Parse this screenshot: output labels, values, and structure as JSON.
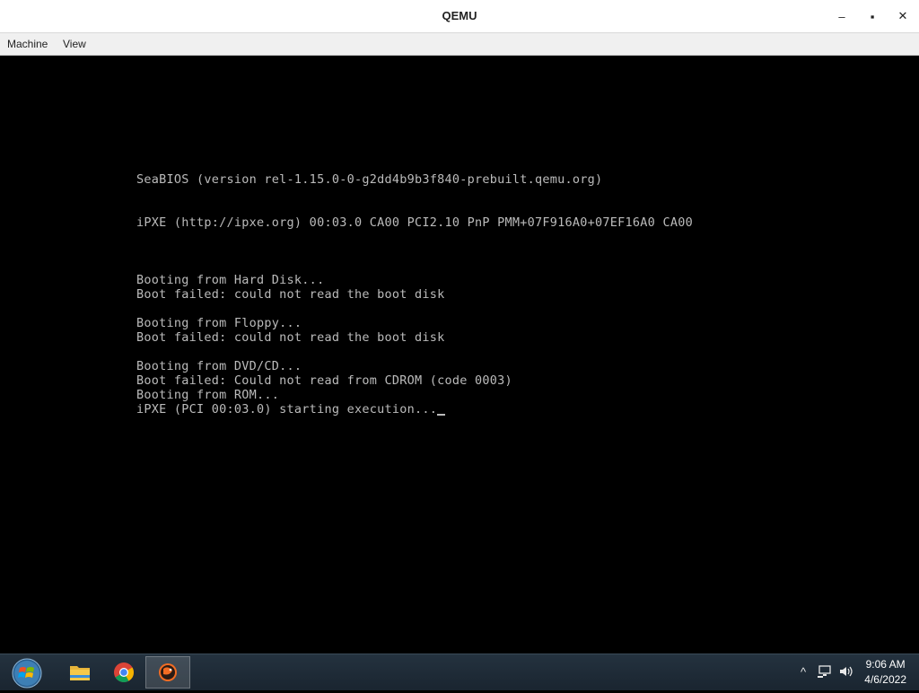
{
  "window": {
    "title": "QEMU",
    "minimize_glyph": "–",
    "maximize_glyph": "▪",
    "close_glyph": "✕"
  },
  "menu": {
    "items": [
      "Machine",
      "View"
    ]
  },
  "console": {
    "lines": [
      "SeaBIOS (version rel-1.15.0-0-g2dd4b9b3f840-prebuilt.qemu.org)",
      "iPXE (http://ipxe.org) 00:03.0 CA00 PCI2.10 PnP PMM+07F916A0+07EF16A0 CA00",
      "Booting from Hard Disk...",
      "Boot failed: could not read the boot disk",
      "Booting from Floppy...",
      "Boot failed: could not read the boot disk",
      "Booting from DVD/CD...",
      "Boot failed: Could not read from CDROM (code 0003)",
      "Booting from ROM...",
      "iPXE (PCI 00:03.0) starting execution..."
    ]
  },
  "taskbar": {
    "apps": [
      {
        "name": "file-explorer",
        "icon": "folder-icon"
      },
      {
        "name": "chrome",
        "icon": "chrome-icon"
      },
      {
        "name": "qemu",
        "icon": "qemu-icon"
      }
    ],
    "tray": {
      "chevron": "^",
      "time": "9:06 AM",
      "date": "4/6/2022"
    }
  },
  "colors": {
    "console_text": "#bbbbbb",
    "console_bg": "#000000",
    "taskbar_bg": "#1a2530"
  }
}
